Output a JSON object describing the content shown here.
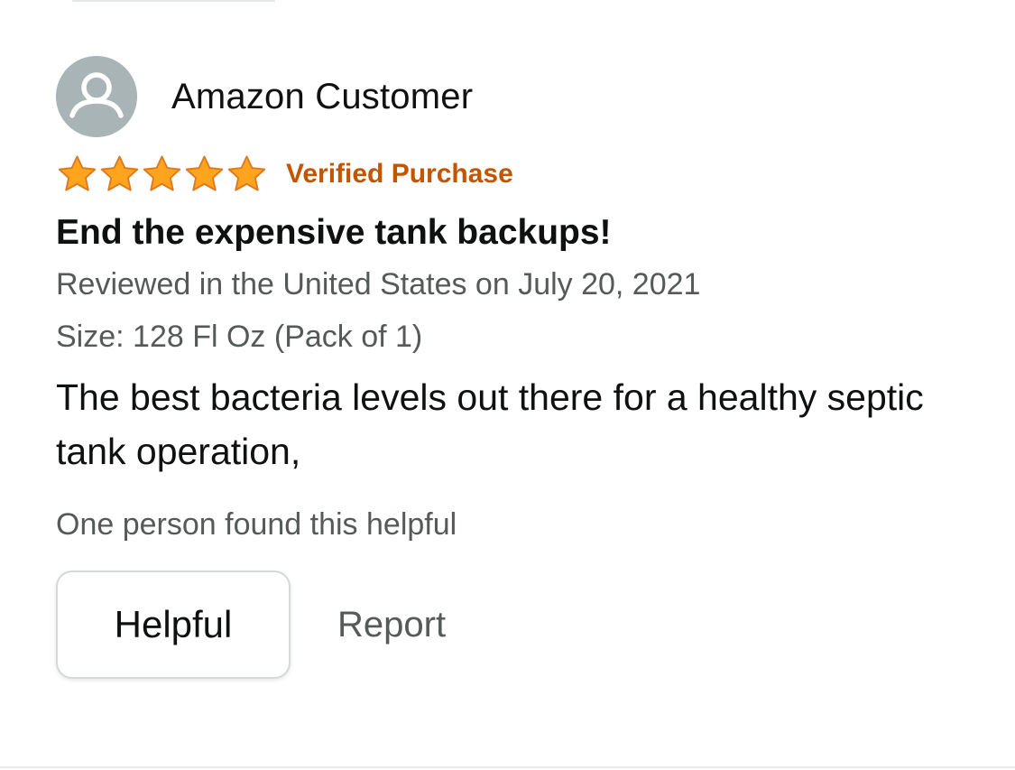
{
  "reviewer": {
    "name": "Amazon Customer",
    "avatar_icon": "user-silhouette-icon",
    "avatar_color": "#a9b4b6"
  },
  "rating": {
    "stars": 5,
    "max_stars": 5,
    "star_color": "#ffa41c",
    "star_icon": "star-icon"
  },
  "verified_label": "Verified Purchase",
  "verified_color": "#c45500",
  "review": {
    "title": "End the expensive tank backups!",
    "date_line": "Reviewed in the United States on July 20, 2021",
    "size_line": "Size: 128 Fl Oz (Pack of 1)",
    "body": "The best bacteria levels out there for a healthy septic tank operation,",
    "helpful_count_text": "One person found this helpful"
  },
  "actions": {
    "helpful_label": "Helpful",
    "report_label": "Report"
  }
}
